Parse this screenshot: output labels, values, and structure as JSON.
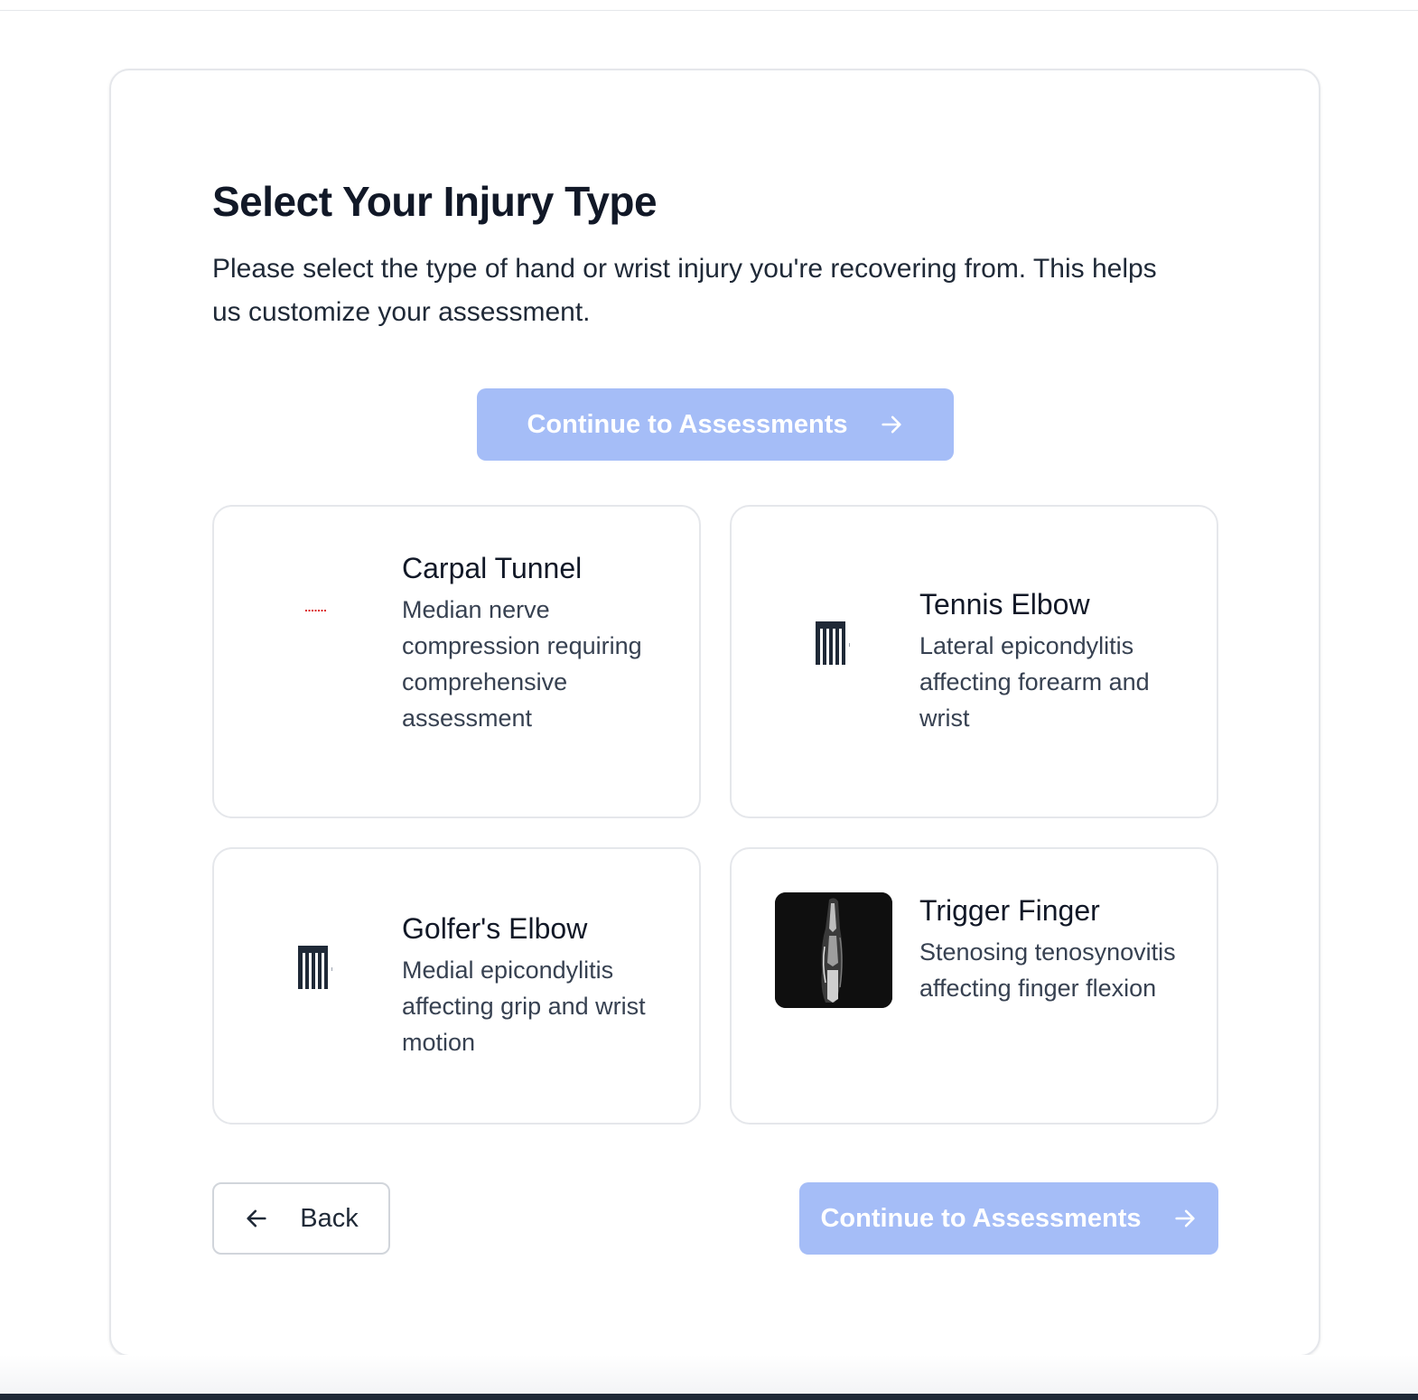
{
  "page": {
    "title": "Select Your Injury Type",
    "subtitle": "Please select the type of hand or wrist injury you're recovering from. This helps us customize your assessment."
  },
  "actions": {
    "continue_label": "Continue to Assessments",
    "back_label": "Back",
    "continue_enabled": false
  },
  "injuries": [
    {
      "title": "Carpal Tunnel",
      "description": "Median nerve compression requiring comprehensive assessment",
      "icon": "broken-image-icon"
    },
    {
      "title": "Tennis Elbow",
      "description": "Lateral epicondylitis affecting forearm and wrist",
      "icon": "broken-image-icon"
    },
    {
      "title": "Golfer's Elbow",
      "description": "Medial epicondylitis affecting grip and wrist motion",
      "icon": "broken-image-icon"
    },
    {
      "title": "Trigger Finger",
      "description": "Stenosing tenosynovitis affecting finger flexion",
      "icon": "finger-mri-image"
    }
  ],
  "colors": {
    "primary_disabled": "#a5bdf7",
    "text_dark": "#111827",
    "border": "#e5e7eb"
  }
}
